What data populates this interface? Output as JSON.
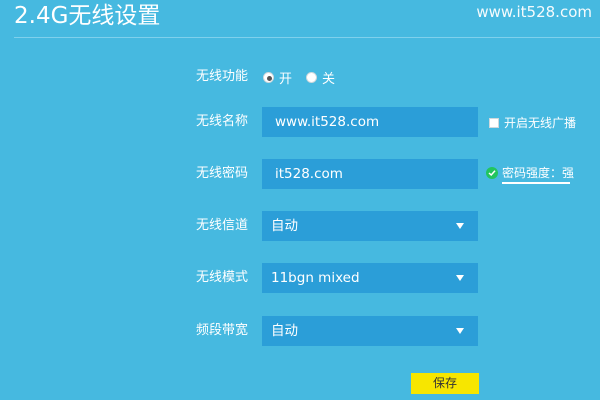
{
  "header": {
    "title": "2.4G无线设置",
    "watermark": "www.it528.com"
  },
  "wireless_function": {
    "label": "无线功能",
    "options": [
      {
        "label": "开",
        "checked": true
      },
      {
        "label": "关",
        "checked": false
      }
    ]
  },
  "wireless_name": {
    "label": "无线名称",
    "value": "www.it528.com",
    "broadcast_label": "开启无线广播",
    "broadcast_checked": false
  },
  "wireless_password": {
    "label": "无线密码",
    "value": "it528.com",
    "strength_text": "密码强度：强"
  },
  "wireless_channel": {
    "label": "无线信道",
    "value": "自动"
  },
  "wireless_mode": {
    "label": "无线模式",
    "value": "11bgn mixed"
  },
  "bandwidth": {
    "label": "频段带宽",
    "value": "自动"
  },
  "actions": {
    "save_label": "保存"
  },
  "colors": {
    "background": "#46b9e0",
    "field": "#2b9ed8",
    "save_button": "#f7e600",
    "check_icon": "#22c55e"
  }
}
